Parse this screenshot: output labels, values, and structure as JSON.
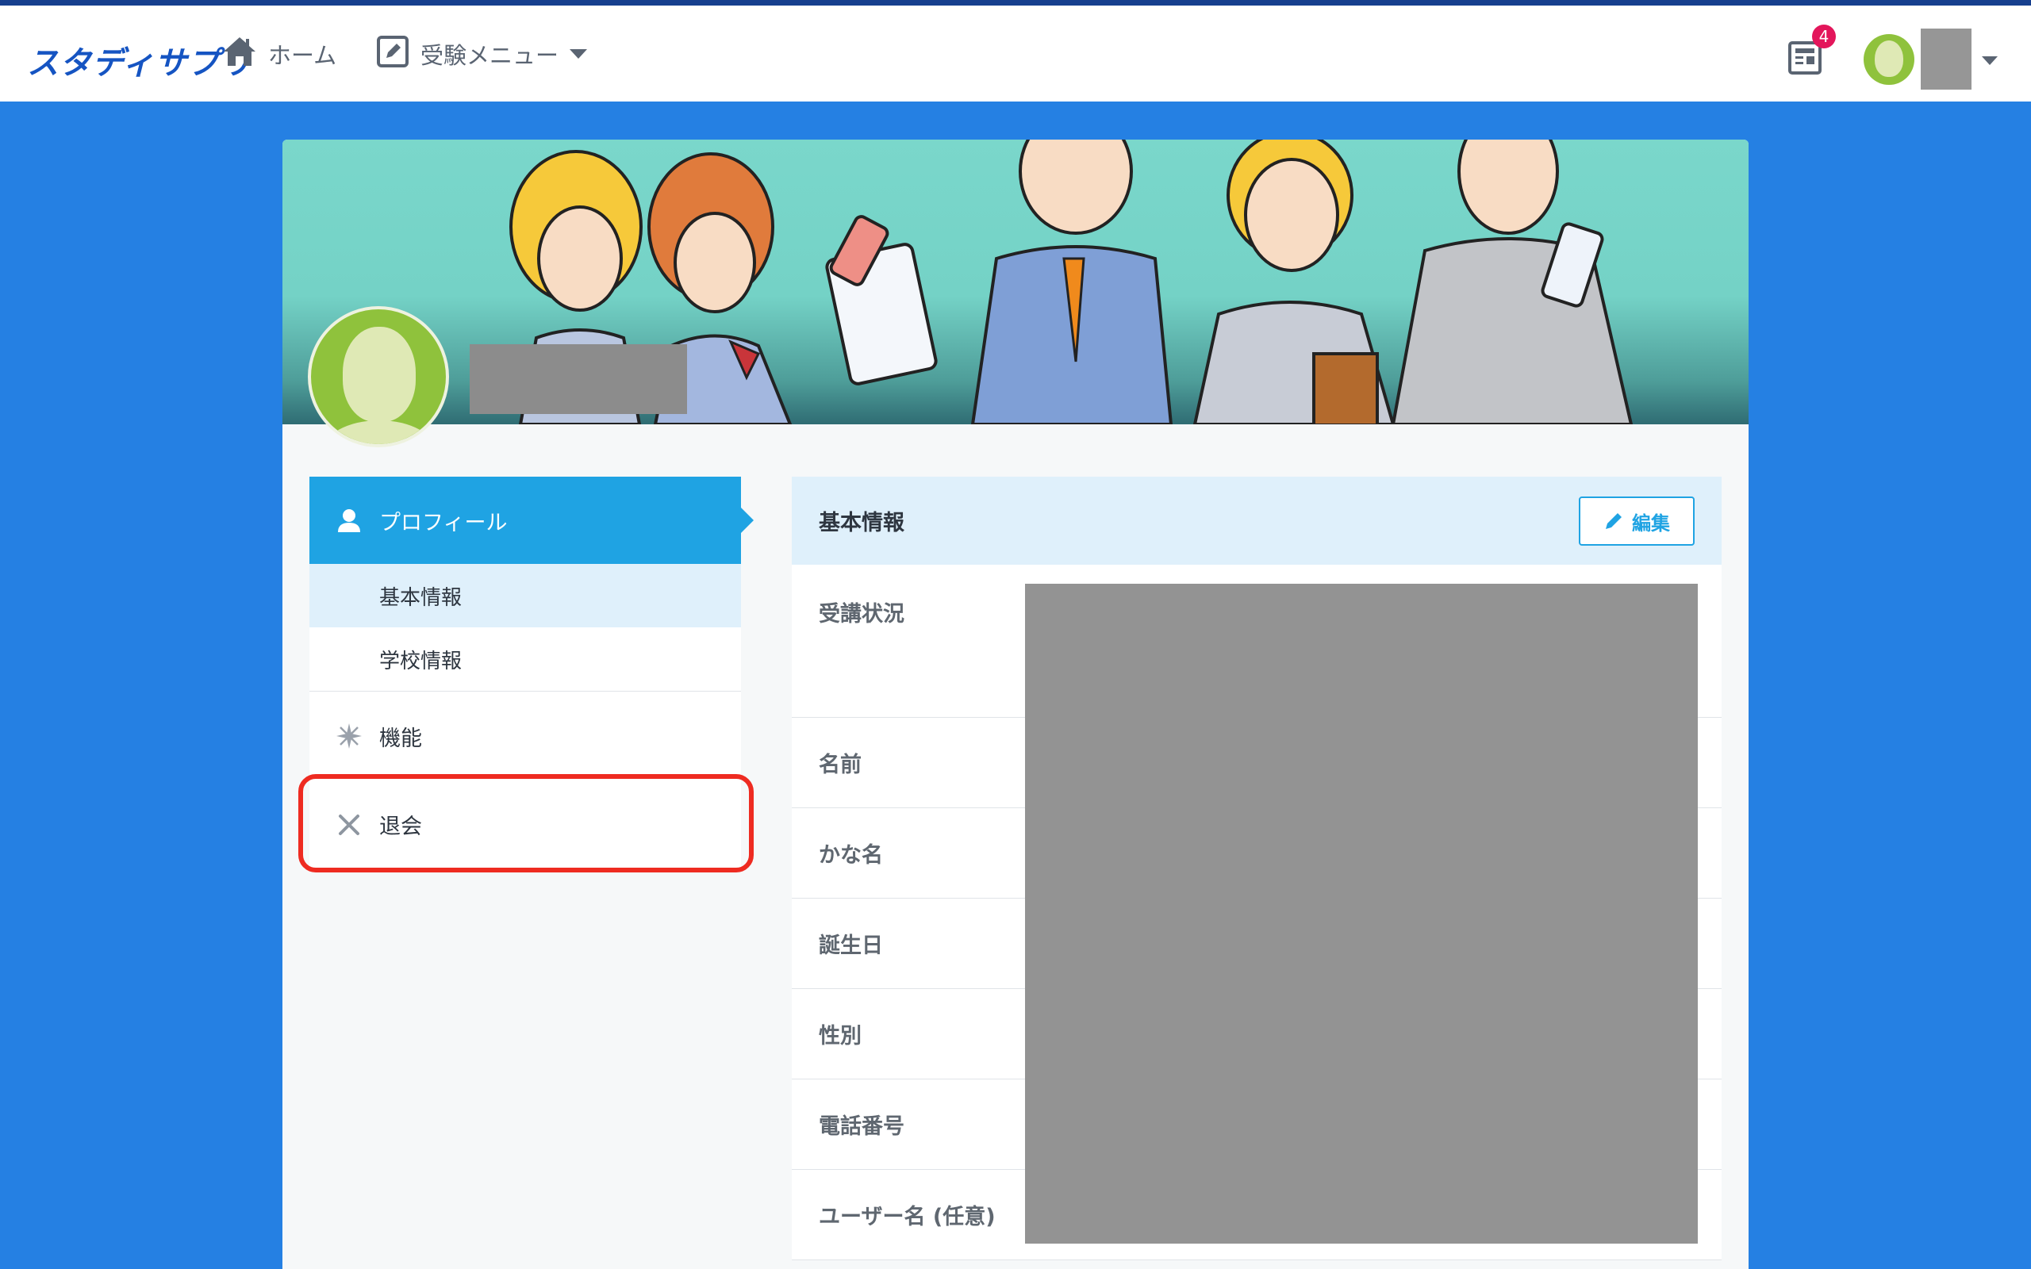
{
  "header": {
    "logo": "スタディサプリ",
    "nav": {
      "home": "ホーム",
      "exam_menu": "受験メニュー"
    },
    "news_badge": "4",
    "icons": [
      "home-icon",
      "exam-menu-icon",
      "news-icon",
      "avatar"
    ]
  },
  "sidebar": {
    "profile": "プロフィール",
    "basic_info": "基本情報",
    "school_info": "学校情報",
    "features": "機能",
    "withdraw": "退会"
  },
  "panel": {
    "title": "基本情報",
    "edit_label": "編集",
    "rows": [
      "受講状況",
      "名前",
      "かな名",
      "誕生日",
      "性別",
      "電話番号",
      "ユーザー名 (任意)"
    ]
  },
  "colors": {
    "background": "#2580e3",
    "accent": "#1fa3e3",
    "highlight": "#ee2b21",
    "badge": "#e3165b"
  }
}
